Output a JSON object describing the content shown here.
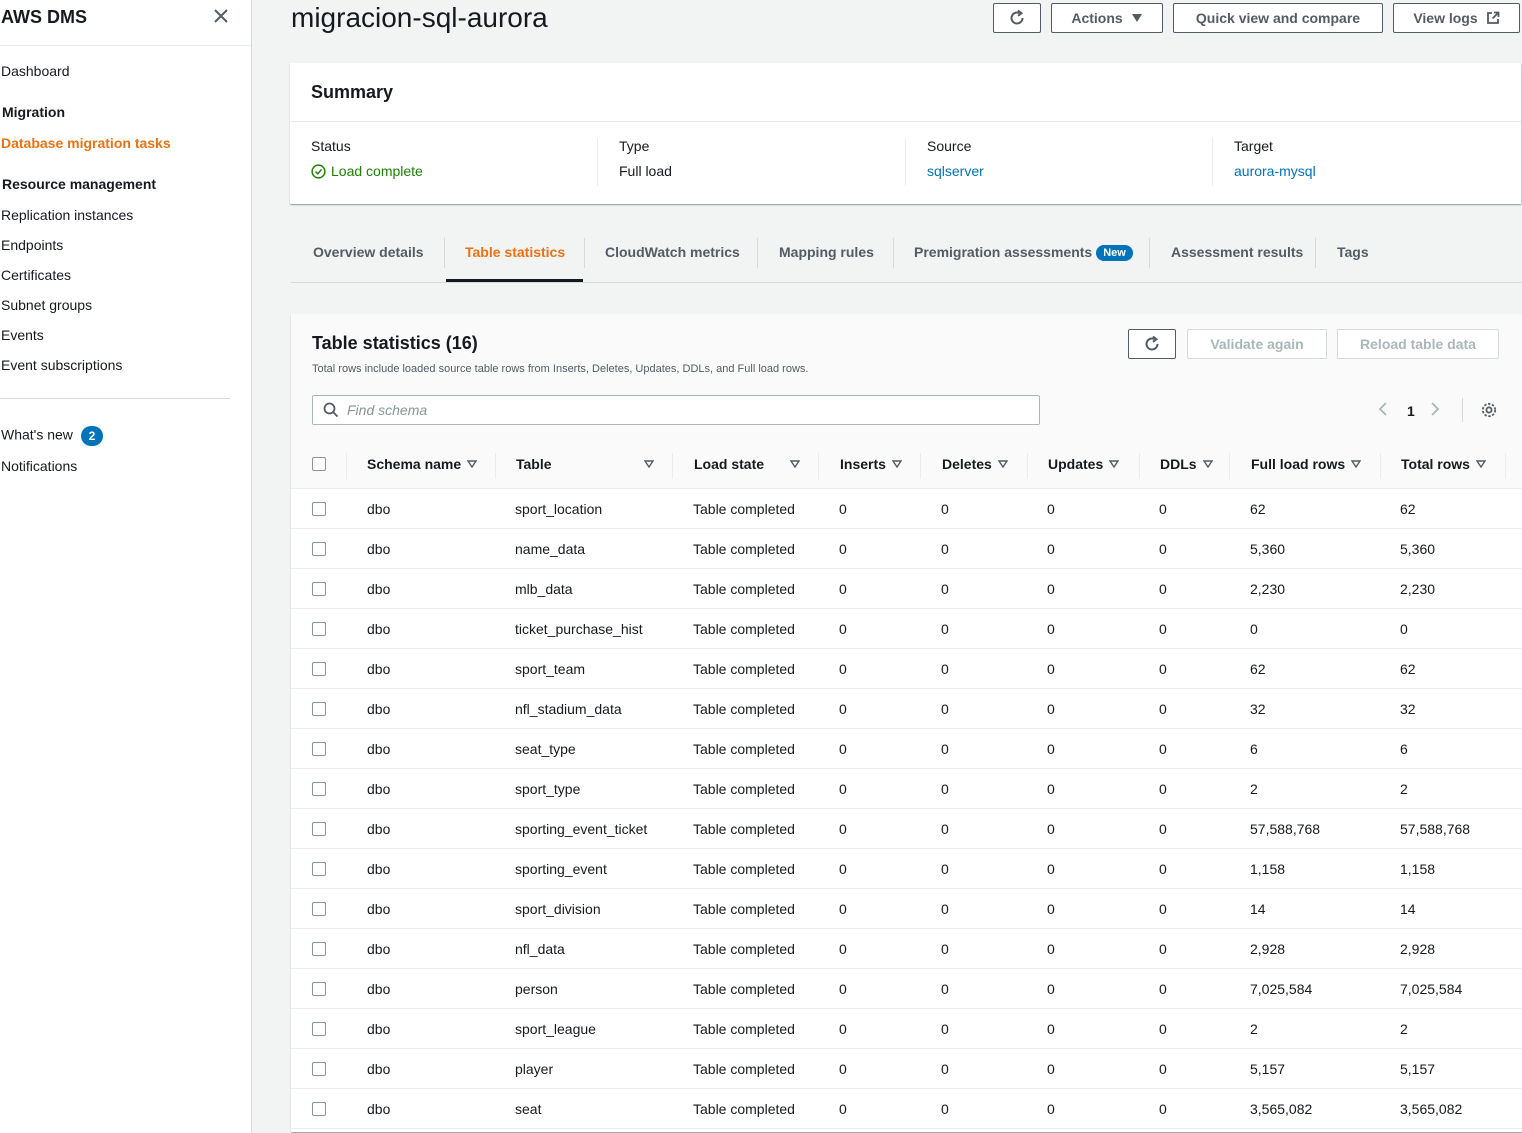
{
  "sidebar": {
    "title": "AWS DMS",
    "dashboard": "Dashboard",
    "migration_section": "Migration",
    "migration_active": "Database migration tasks",
    "resource_section": "Resource management",
    "resource_items": [
      "Replication instances",
      "Endpoints",
      "Certificates",
      "Subnet groups",
      "Events",
      "Event subscriptions"
    ],
    "whats_new": "What's new",
    "whats_new_count": "2",
    "notifications": "Notifications"
  },
  "header": {
    "title": "migracion-sql-aurora",
    "actions_label": "Actions",
    "quick_view_label": "Quick view and compare",
    "view_logs_label": "View logs"
  },
  "summary": {
    "title": "Summary",
    "status_label": "Status",
    "status_value": "Load complete",
    "type_label": "Type",
    "type_value": "Full load",
    "source_label": "Source",
    "source_value": "sqlserver",
    "target_label": "Target",
    "target_value": "aurora-mysql",
    "status_color": "#1d8102",
    "link_color": "#0073bb"
  },
  "tabs": {
    "items": [
      "Overview details",
      "Table statistics",
      "CloudWatch metrics",
      "Mapping rules",
      "Premigration assessments",
      "Assessment results",
      "Tags"
    ],
    "new_badge": "New",
    "active": "Table statistics",
    "accent": "#ec7211"
  },
  "table_panel": {
    "title": "Table statistics (16)",
    "description": "Total rows include loaded source table rows from Inserts, Deletes, Updates, DDLs, and Full load rows.",
    "validate_label": "Validate again",
    "reload_label": "Reload table data",
    "search_placeholder": "Find schema",
    "page": "1",
    "columns": [
      "Schema name",
      "Table",
      "Load state",
      "Inserts",
      "Deletes",
      "Updates",
      "DDLs",
      "Full load rows",
      "Total rows"
    ],
    "rows": [
      [
        "dbo",
        "sport_location",
        "Table completed",
        "0",
        "0",
        "0",
        "0",
        "62",
        "62"
      ],
      [
        "dbo",
        "name_data",
        "Table completed",
        "0",
        "0",
        "0",
        "0",
        "5,360",
        "5,360"
      ],
      [
        "dbo",
        "mlb_data",
        "Table completed",
        "0",
        "0",
        "0",
        "0",
        "2,230",
        "2,230"
      ],
      [
        "dbo",
        "ticket_purchase_hist",
        "Table completed",
        "0",
        "0",
        "0",
        "0",
        "0",
        "0"
      ],
      [
        "dbo",
        "sport_team",
        "Table completed",
        "0",
        "0",
        "0",
        "0",
        "62",
        "62"
      ],
      [
        "dbo",
        "nfl_stadium_data",
        "Table completed",
        "0",
        "0",
        "0",
        "0",
        "32",
        "32"
      ],
      [
        "dbo",
        "seat_type",
        "Table completed",
        "0",
        "0",
        "0",
        "0",
        "6",
        "6"
      ],
      [
        "dbo",
        "sport_type",
        "Table completed",
        "0",
        "0",
        "0",
        "0",
        "2",
        "2"
      ],
      [
        "dbo",
        "sporting_event_ticket",
        "Table completed",
        "0",
        "0",
        "0",
        "0",
        "57,588,768",
        "57,588,768"
      ],
      [
        "dbo",
        "sporting_event",
        "Table completed",
        "0",
        "0",
        "0",
        "0",
        "1,158",
        "1,158"
      ],
      [
        "dbo",
        "sport_division",
        "Table completed",
        "0",
        "0",
        "0",
        "0",
        "14",
        "14"
      ],
      [
        "dbo",
        "nfl_data",
        "Table completed",
        "0",
        "0",
        "0",
        "0",
        "2,928",
        "2,928"
      ],
      [
        "dbo",
        "person",
        "Table completed",
        "0",
        "0",
        "0",
        "0",
        "7,025,584",
        "7,025,584"
      ],
      [
        "dbo",
        "sport_league",
        "Table completed",
        "0",
        "0",
        "0",
        "0",
        "2",
        "2"
      ],
      [
        "dbo",
        "player",
        "Table completed",
        "0",
        "0",
        "0",
        "0",
        "5,157",
        "5,157"
      ],
      [
        "dbo",
        "seat",
        "Table completed",
        "0",
        "0",
        "0",
        "0",
        "3,565,082",
        "3,565,082"
      ]
    ]
  }
}
